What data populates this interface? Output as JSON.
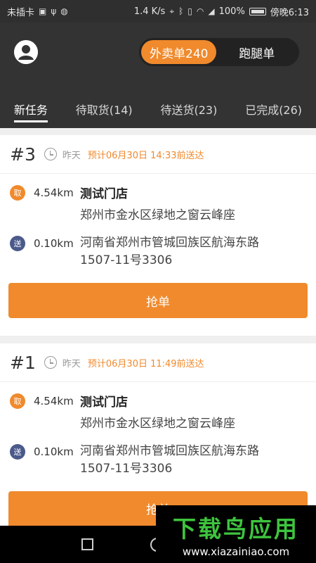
{
  "status_bar": {
    "carrier": "未插卡",
    "speed": "1.4 K/s",
    "battery": "100%",
    "time": "傍晚6:13"
  },
  "header": {
    "segments": [
      {
        "label": "外卖单240",
        "active": true
      },
      {
        "label": "跑腿单",
        "active": false
      }
    ],
    "tabs": [
      {
        "label": "新任务",
        "active": true
      },
      {
        "label": "待取货(14)",
        "active": false
      },
      {
        "label": "待送货(23)",
        "active": false
      },
      {
        "label": "已完成(26)",
        "active": false
      }
    ]
  },
  "orders": [
    {
      "number": "#3",
      "day": "昨天",
      "deadline": "预计06月30日 14:33前送达",
      "pickup": {
        "badge": "取",
        "distance": "4.54km",
        "store": "测试门店",
        "address": "郑州市金水区绿地之窗云峰座"
      },
      "delivery": {
        "badge": "送",
        "distance": "0.10km",
        "address_line1": "河南省郑州市管城回族区航海东路",
        "address_line2": "1507-11号3306"
      },
      "button": "抢单"
    },
    {
      "number": "#1",
      "day": "昨天",
      "deadline": "预计06月30日 11:49前送达",
      "pickup": {
        "badge": "取",
        "distance": "4.54km",
        "store": "测试门店",
        "address": "郑州市金水区绿地之窗云峰座"
      },
      "delivery": {
        "badge": "送",
        "distance": "0.10km",
        "address_line1": "河南省郑州市管城回族区航海东路",
        "address_line2": "1507-11号3306"
      },
      "button": "抢单"
    }
  ],
  "watermark": {
    "title": "下载鸟应用",
    "url": "www.xiazainiao.com"
  },
  "colors": {
    "accent": "#f08a2c",
    "header_bg": "#333333",
    "delivery_badge": "#4a5a8a"
  }
}
